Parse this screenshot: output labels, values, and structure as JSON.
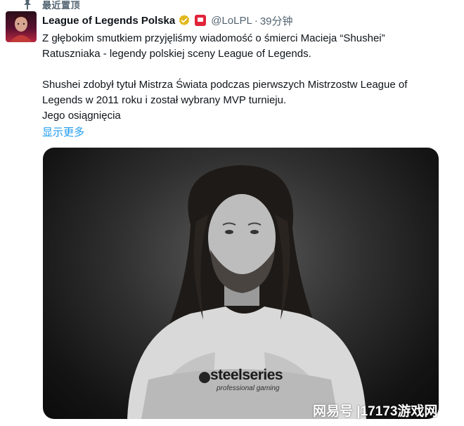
{
  "pinned": {
    "label": "最近置顶",
    "icon": "pin-icon"
  },
  "tweet": {
    "display_name": "League of Legends Polska",
    "verified_icon": "verified-badge-icon",
    "affiliate_badge_icon": "affiliate-badge-icon",
    "handle": "@LoLPL",
    "separator": "·",
    "timestamp": "39分钟",
    "text_line_1": "Z głębokim smutkiem przyjęliśmy wiadomość o śmierci Macieja “Shushei”",
    "text_line_2": "Ratuszniaka - legendy polskiej sceny League of Legends.",
    "text_line_3": "Shushei zdobył tytuł Mistrza Świata podczas pierwszych Mistrzostw League of",
    "text_line_4": "Legends w 2011 roku i został wybrany MVP turnieju.",
    "text_line_5": "Jego osiągnięcia",
    "show_more": "显示更多"
  },
  "photo": {
    "shirt_brand": "steelseries",
    "shirt_sub": "professional gaming"
  },
  "watermark": "网易号 |17173游戏网",
  "colors": {
    "accent": "#1d9bf0",
    "verified_gold": "#e2b719",
    "text": "#0f1419",
    "muted": "#536471",
    "affiliate_red": "#e0243a"
  }
}
